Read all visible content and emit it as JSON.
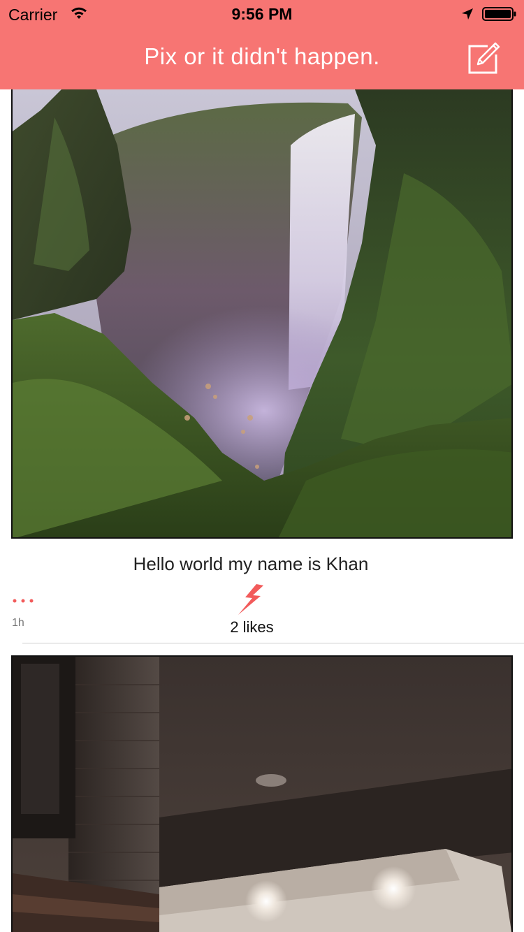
{
  "status_bar": {
    "carrier": "Carrier",
    "time": "9:56 PM",
    "icons": [
      "wifi-icon",
      "location-arrow-icon",
      "battery-icon"
    ]
  },
  "nav_bar": {
    "title": "Pix or it didn't happen.",
    "compose_icon": "compose-icon",
    "background_color": "#f77573",
    "title_color": "#ffffff"
  },
  "feed": {
    "posts": [
      {
        "image": "waterfall-photo",
        "caption": "Hello world my name is Khan",
        "timestamp": "1h",
        "likes": "2 likes",
        "like_icon": "lightning-bolt-icon",
        "more_icon": "more-dots-icon"
      },
      {
        "image": "room-ceiling-photo"
      }
    ]
  },
  "colors": {
    "accent": "#f25b5b"
  }
}
